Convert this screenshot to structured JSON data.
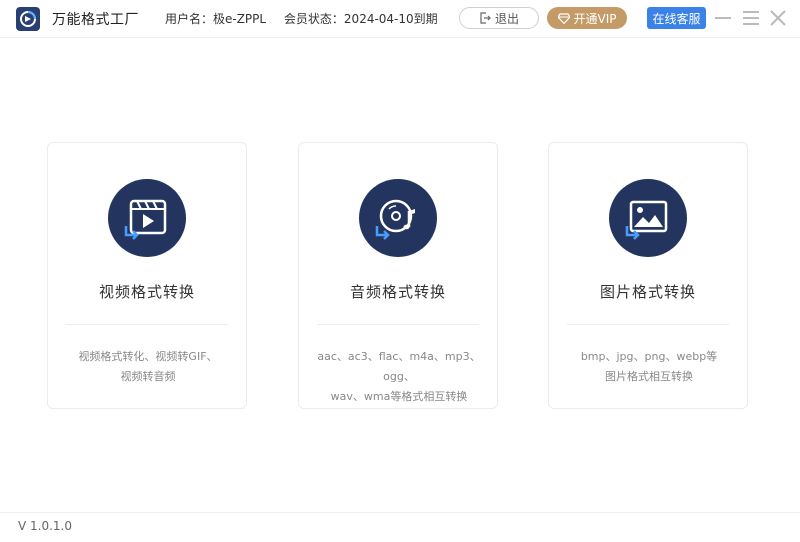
{
  "header": {
    "app_title": "万能格式工厂",
    "username": "用户名：极e-ZPPL",
    "member_status": "会员状态：2024-04-10到期",
    "logout_label": "退出",
    "vip_label": "开通VIP",
    "service_label": "在线客服"
  },
  "cards": [
    {
      "title": "视频格式转换",
      "desc_line1": "视频格式转化、视频转GIF、",
      "desc_line2": "视频转音频",
      "icon": "video-convert-icon"
    },
    {
      "title": "音频格式转换",
      "desc_line1": "aac、ac3、flac、m4a、mp3、ogg、",
      "desc_line2": "wav、wma等格式相互转换",
      "icon": "audio-convert-icon"
    },
    {
      "title": "图片格式转换",
      "desc_line1": "bmp、jpg、png、webp等",
      "desc_line2": "图片格式相互转换",
      "icon": "image-convert-icon"
    }
  ],
  "footer": {
    "version": "V 1.0.1.0"
  },
  "colors": {
    "accent_blue": "#3b82e8",
    "vip_gold": "#c49a66",
    "icon_navy": "#23355e"
  }
}
